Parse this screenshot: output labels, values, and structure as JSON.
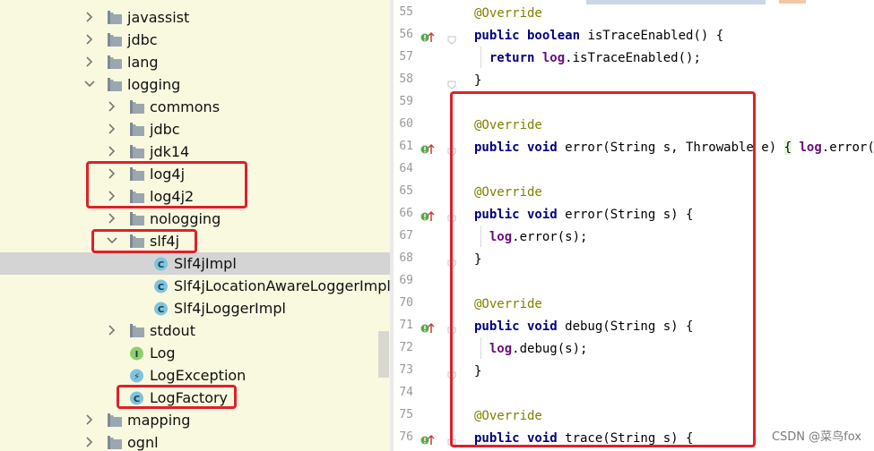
{
  "tree": {
    "items": [
      {
        "label": "javassist",
        "kind": "package",
        "expanded": false,
        "indent": 0
      },
      {
        "label": "jdbc",
        "kind": "package",
        "expanded": false,
        "indent": 0
      },
      {
        "label": "lang",
        "kind": "package",
        "expanded": false,
        "indent": 0
      },
      {
        "label": "logging",
        "kind": "package",
        "expanded": true,
        "indent": 0
      },
      {
        "label": "commons",
        "kind": "package",
        "expanded": false,
        "indent": 1
      },
      {
        "label": "jdbc",
        "kind": "package",
        "expanded": false,
        "indent": 1
      },
      {
        "label": "jdk14",
        "kind": "package",
        "expanded": false,
        "indent": 1
      },
      {
        "label": "log4j",
        "kind": "package",
        "expanded": false,
        "indent": 1
      },
      {
        "label": "log4j2",
        "kind": "package",
        "expanded": false,
        "indent": 1
      },
      {
        "label": "nologging",
        "kind": "package",
        "expanded": false,
        "indent": 1
      },
      {
        "label": "slf4j",
        "kind": "package",
        "expanded": true,
        "indent": 1
      },
      {
        "label": "Slf4jImpl",
        "kind": "class",
        "selected": true,
        "indent": 2
      },
      {
        "label": "Slf4jLocationAwareLoggerImpl",
        "kind": "class",
        "indent": 2
      },
      {
        "label": "Slf4jLoggerImpl",
        "kind": "class",
        "indent": 2
      },
      {
        "label": "stdout",
        "kind": "package",
        "expanded": false,
        "indent": 1
      },
      {
        "label": "Log",
        "kind": "interface",
        "indent": 1
      },
      {
        "label": "LogException",
        "kind": "exception",
        "indent": 1
      },
      {
        "label": "LogFactory",
        "kind": "class-leaf",
        "indent": 1
      },
      {
        "label": "mapping",
        "kind": "package",
        "expanded": false,
        "indent": 0
      },
      {
        "label": "ognl",
        "kind": "package",
        "expanded": false,
        "indent": 0
      }
    ]
  },
  "editor": {
    "lines": [
      {
        "num": "55",
        "code": "<span class=\"ann\">@Override</span>",
        "gutter": false,
        "fold": false
      },
      {
        "num": "56",
        "code": "<span class=\"kw\">public boolean</span> isTraceEnabled() {",
        "gutter": true,
        "fold": true
      },
      {
        "num": "57",
        "code": "  <span class=\"kw\">return</span> <span class=\"fld\">log</span>.isTraceEnabled();",
        "gutter": false,
        "fold": false
      },
      {
        "num": "58",
        "code": "}",
        "gutter": false,
        "fold": true
      },
      {
        "num": "59",
        "code": "",
        "gutter": false,
        "fold": false
      },
      {
        "num": "60",
        "code": "<span class=\"ann\">@Override</span>",
        "gutter": false,
        "fold": false
      },
      {
        "num": "61",
        "code": "<span class=\"kw\">public void</span> error(String s, Throwable e) <span class=\"brace-hl\">{</span> <span class=\"fld\">log</span>.error(s, e); }",
        "gutter": true,
        "fold": true
      },
      {
        "num": "64",
        "code": "",
        "gutter": false,
        "fold": false
      },
      {
        "num": "65",
        "code": "<span class=\"ann\">@Override</span>",
        "gutter": false,
        "fold": false
      },
      {
        "num": "66",
        "code": "<span class=\"kw\">public void</span> error(String s) {",
        "gutter": true,
        "fold": true
      },
      {
        "num": "67",
        "code": "  <span class=\"fld\">log</span>.error(s);",
        "gutter": false,
        "fold": false
      },
      {
        "num": "68",
        "code": "}",
        "gutter": false,
        "fold": true
      },
      {
        "num": "69",
        "code": "",
        "gutter": false,
        "fold": false
      },
      {
        "num": "70",
        "code": "<span class=\"ann\">@Override</span>",
        "gutter": false,
        "fold": false
      },
      {
        "num": "71",
        "code": "<span class=\"kw\">public void</span> debug(String s) {",
        "gutter": true,
        "fold": true
      },
      {
        "num": "72",
        "code": "  <span class=\"fld\">log</span>.debug(s);",
        "gutter": false,
        "fold": false
      },
      {
        "num": "73",
        "code": "}",
        "gutter": false,
        "fold": true
      },
      {
        "num": "74",
        "code": "",
        "gutter": false,
        "fold": false
      },
      {
        "num": "75",
        "code": "<span class=\"ann\">@Override</span>",
        "gutter": false,
        "fold": false
      },
      {
        "num": "76",
        "code": "<span class=\"kw\">public void</span> trace(String s) {",
        "gutter": true,
        "fold": true
      }
    ]
  },
  "watermark": "CSDN @菜鸟fox",
  "colors": {
    "annotation_red": "#e0202a",
    "tree_bg": "#f9f9e0",
    "selection": "#d4d4d4",
    "keyword": "#000080",
    "field": "#660e7a",
    "annotation": "#808000"
  }
}
